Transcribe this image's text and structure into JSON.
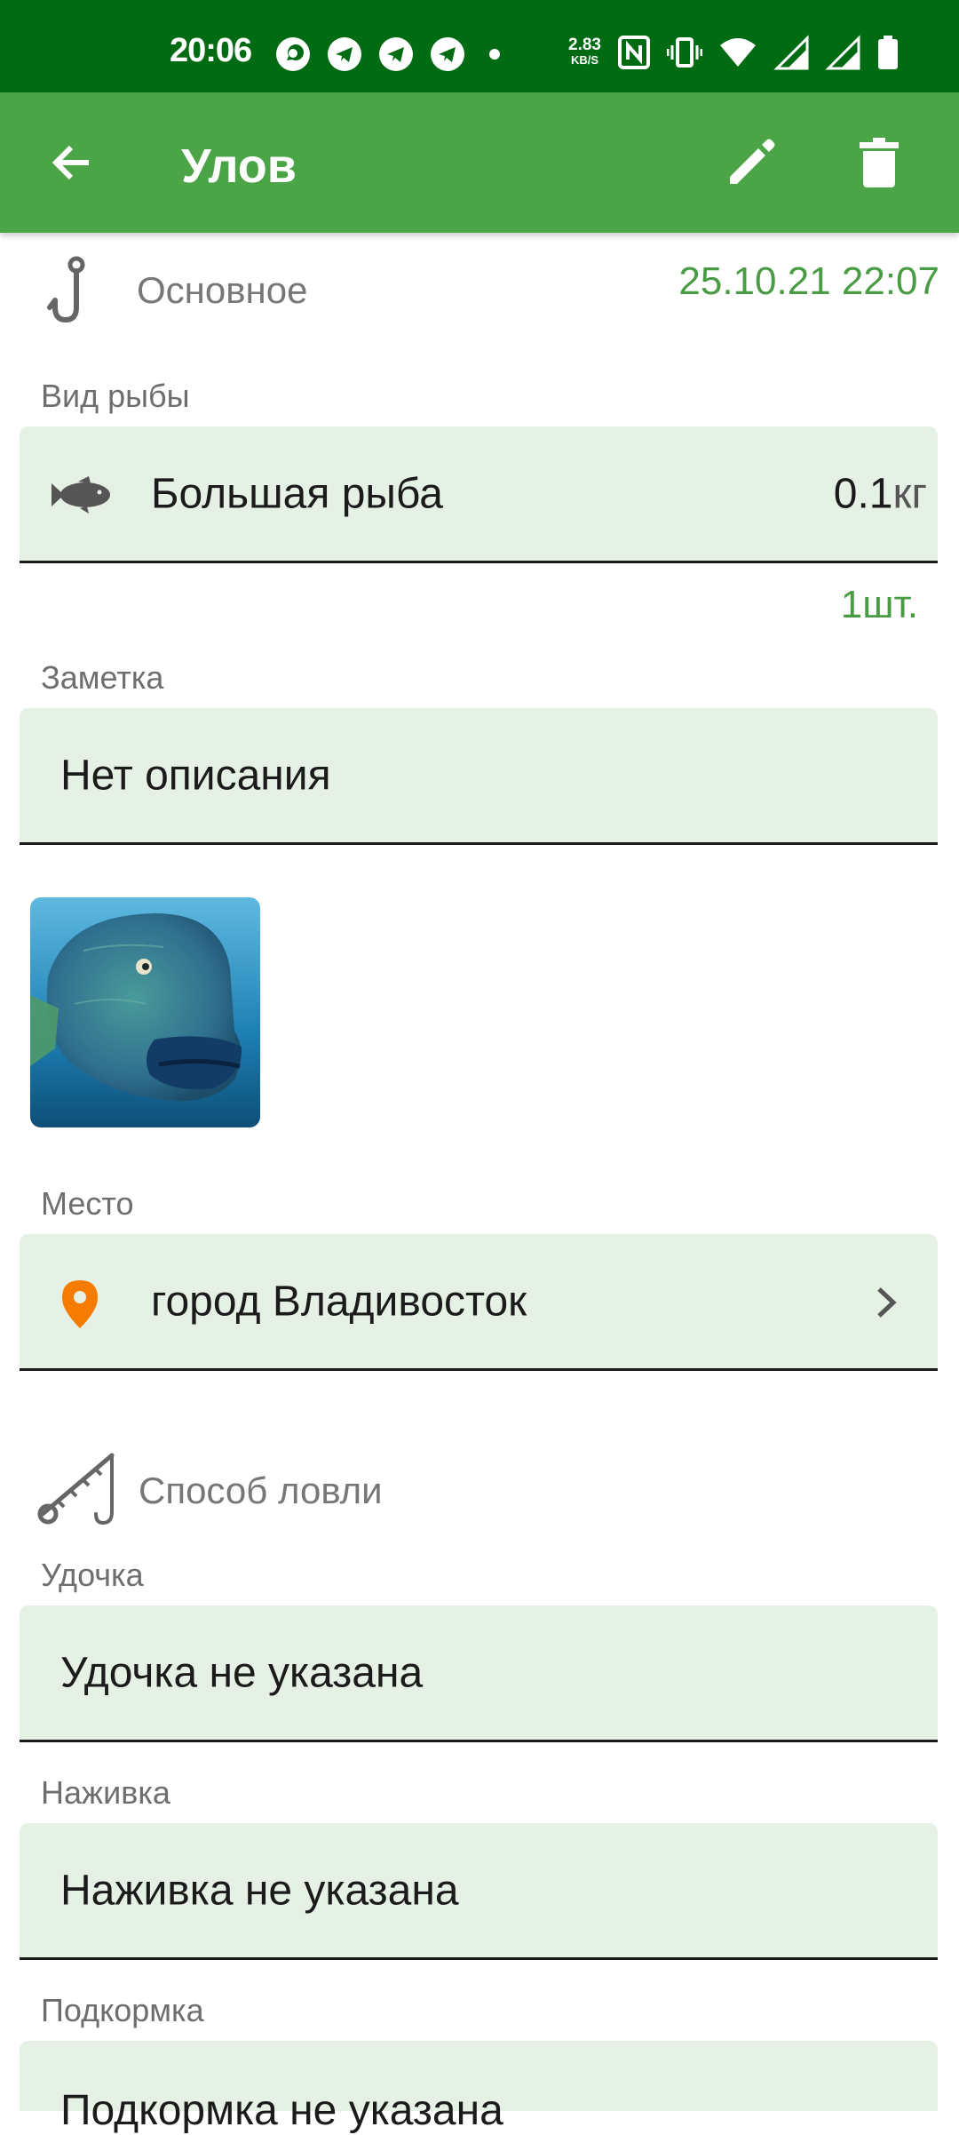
{
  "status_bar": {
    "time": "20:06",
    "net_speed_value": "2.83",
    "net_speed_unit": "KB/S",
    "icons": [
      "whatsapp-icon",
      "telegram-icon",
      "telegram-icon",
      "telegram-icon",
      "dot-icon",
      "nfc-icon",
      "vibrate-icon",
      "wifi-icon",
      "signal-icon",
      "signal-icon",
      "battery-icon"
    ]
  },
  "app_bar": {
    "title": "Улов",
    "back_icon": "arrow-back-icon",
    "edit_icon": "pencil-icon",
    "delete_icon": "trash-icon"
  },
  "main_section": {
    "title": "Основное",
    "icon": "fish-hook-icon",
    "datetime": "25.10.21 22:07"
  },
  "fish": {
    "label": "Вид рыбы",
    "name": "Большая рыба",
    "weight_value": "0.1",
    "weight_unit": "кг",
    "count": "1шт."
  },
  "note": {
    "label": "Заметка",
    "value": "Нет описания"
  },
  "place": {
    "label": "Место",
    "value": "город Владивосток"
  },
  "method_section": {
    "title": "Способ ловли",
    "icon": "fishing-rod-icon"
  },
  "rod": {
    "label": "Удочка",
    "value": "Удочка не указана"
  },
  "bait": {
    "label": "Наживка",
    "value": "Наживка не указана"
  },
  "groundbait": {
    "label": "Подкормка",
    "value": "Подкормка не указана"
  },
  "colors": {
    "status_bar": "#006b12",
    "app_bar": "#4ba446",
    "accent_text": "#4a9c44",
    "field_bg": "#e6f1e6",
    "place_pin": "#f57c00"
  }
}
